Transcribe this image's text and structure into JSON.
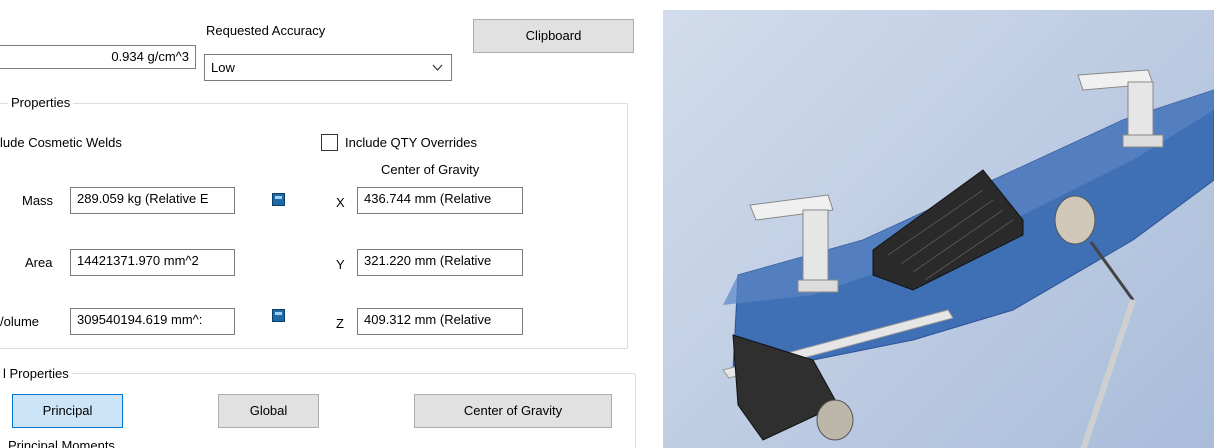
{
  "density": {
    "value": "0.934 g/cm^3"
  },
  "accuracy": {
    "label": "Requested Accuracy",
    "selected": "Low"
  },
  "clipboard_label": "Clipboard",
  "general_properties": {
    "title": "Properties",
    "include_cosmetic_welds": "lude Cosmetic Welds",
    "include_qty_overrides": "Include QTY Overrides",
    "cog_heading": "Center of Gravity",
    "mass_label": "Mass",
    "mass_value": "289.059 kg (Relative E",
    "area_label": "Area",
    "area_value": "14421371.970 mm^2",
    "volume_label": "/olume",
    "volume_value": "309540194.619 mm^:",
    "x_label": "X",
    "x_value": "436.744 mm (Relative",
    "y_label": "Y",
    "y_value": "321.220 mm (Relative",
    "z_label": "Z",
    "z_value": "409.312 mm (Relative"
  },
  "inertial_properties": {
    "title": "l Properties",
    "principal_label": "Principal",
    "global_label": "Global",
    "cog_label": "Center of Gravity",
    "principal_moments_label": "Principal Moments"
  },
  "colors": {
    "hull": "#3f6fb5",
    "belt": "#2f2f2f",
    "bracket": "#e9e9e9",
    "accent": "#0078d7"
  }
}
